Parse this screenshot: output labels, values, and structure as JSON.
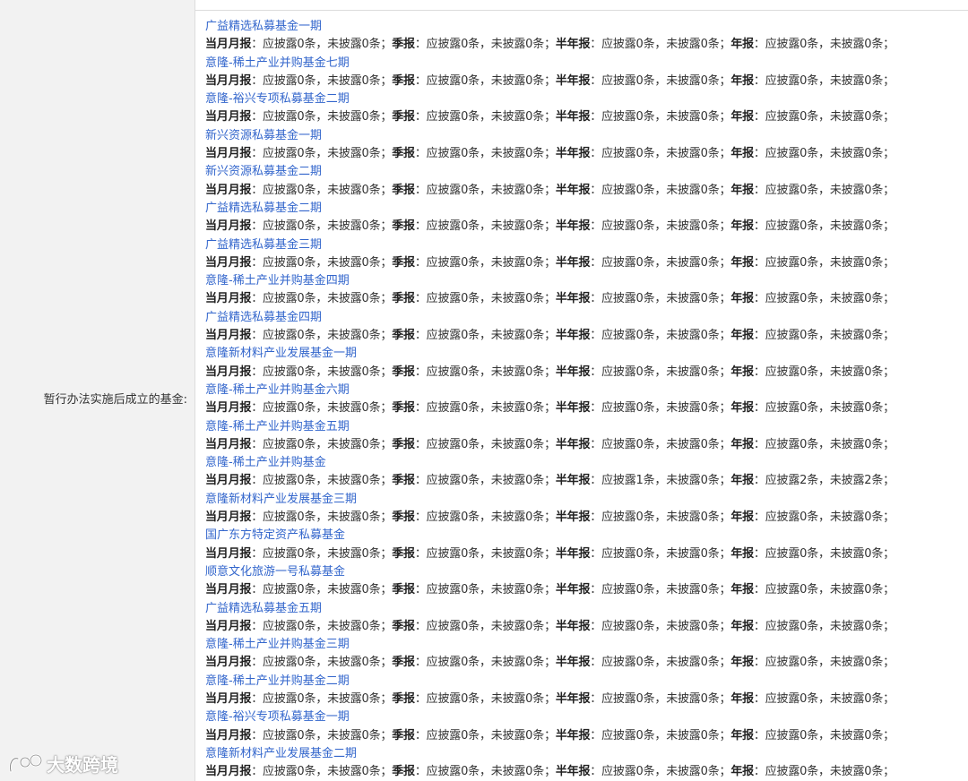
{
  "label": "暂行办法实施后成立的基金:",
  "terms": {
    "monthly": "当月月报",
    "quarterly": "季报",
    "semiannual": "半年报",
    "annual": "年报",
    "should_prefix": "应披露",
    "not_prefix": "未披露",
    "unit": "条"
  },
  "funds": [
    {
      "name": "广益精选私募基金一期",
      "m": [
        0,
        0
      ],
      "q": [
        0,
        0
      ],
      "h": [
        0,
        0
      ],
      "y": [
        0,
        0
      ]
    },
    {
      "name": "意隆-稀土产业并购基金七期",
      "m": [
        0,
        0
      ],
      "q": [
        0,
        0
      ],
      "h": [
        0,
        0
      ],
      "y": [
        0,
        0
      ]
    },
    {
      "name": "意隆-裕兴专项私募基金二期",
      "m": [
        0,
        0
      ],
      "q": [
        0,
        0
      ],
      "h": [
        0,
        0
      ],
      "y": [
        0,
        0
      ]
    },
    {
      "name": "新兴资源私募基金一期",
      "m": [
        0,
        0
      ],
      "q": [
        0,
        0
      ],
      "h": [
        0,
        0
      ],
      "y": [
        0,
        0
      ]
    },
    {
      "name": "新兴资源私募基金二期",
      "m": [
        0,
        0
      ],
      "q": [
        0,
        0
      ],
      "h": [
        0,
        0
      ],
      "y": [
        0,
        0
      ]
    },
    {
      "name": "广益精选私募基金二期",
      "m": [
        0,
        0
      ],
      "q": [
        0,
        0
      ],
      "h": [
        0,
        0
      ],
      "y": [
        0,
        0
      ]
    },
    {
      "name": "广益精选私募基金三期",
      "m": [
        0,
        0
      ],
      "q": [
        0,
        0
      ],
      "h": [
        0,
        0
      ],
      "y": [
        0,
        0
      ]
    },
    {
      "name": "意隆-稀土产业并购基金四期",
      "m": [
        0,
        0
      ],
      "q": [
        0,
        0
      ],
      "h": [
        0,
        0
      ],
      "y": [
        0,
        0
      ]
    },
    {
      "name": "广益精选私募基金四期",
      "m": [
        0,
        0
      ],
      "q": [
        0,
        0
      ],
      "h": [
        0,
        0
      ],
      "y": [
        0,
        0
      ]
    },
    {
      "name": "意隆新材料产业发展基金一期",
      "m": [
        0,
        0
      ],
      "q": [
        0,
        0
      ],
      "h": [
        0,
        0
      ],
      "y": [
        0,
        0
      ]
    },
    {
      "name": "意隆-稀土产业并购基金六期",
      "m": [
        0,
        0
      ],
      "q": [
        0,
        0
      ],
      "h": [
        0,
        0
      ],
      "y": [
        0,
        0
      ]
    },
    {
      "name": "意隆-稀土产业并购基金五期",
      "m": [
        0,
        0
      ],
      "q": [
        0,
        0
      ],
      "h": [
        0,
        0
      ],
      "y": [
        0,
        0
      ]
    },
    {
      "name": "意隆-稀土产业并购基金",
      "m": [
        0,
        0
      ],
      "q": [
        0,
        0
      ],
      "h": [
        1,
        0
      ],
      "y": [
        2,
        2
      ]
    },
    {
      "name": "意隆新材料产业发展基金三期",
      "m": [
        0,
        0
      ],
      "q": [
        0,
        0
      ],
      "h": [
        0,
        0
      ],
      "y": [
        0,
        0
      ]
    },
    {
      "name": "国广东方特定资产私募基金",
      "m": [
        0,
        0
      ],
      "q": [
        0,
        0
      ],
      "h": [
        0,
        0
      ],
      "y": [
        0,
        0
      ]
    },
    {
      "name": "顺意文化旅游一号私募基金",
      "m": [
        0,
        0
      ],
      "q": [
        0,
        0
      ],
      "h": [
        0,
        0
      ],
      "y": [
        0,
        0
      ]
    },
    {
      "name": "广益精选私募基金五期",
      "m": [
        0,
        0
      ],
      "q": [
        0,
        0
      ],
      "h": [
        0,
        0
      ],
      "y": [
        0,
        0
      ]
    },
    {
      "name": "意隆-稀土产业并购基金三期",
      "m": [
        0,
        0
      ],
      "q": [
        0,
        0
      ],
      "h": [
        0,
        0
      ],
      "y": [
        0,
        0
      ]
    },
    {
      "name": "意隆-稀土产业并购基金二期",
      "m": [
        0,
        0
      ],
      "q": [
        0,
        0
      ],
      "h": [
        0,
        0
      ],
      "y": [
        0,
        0
      ]
    },
    {
      "name": "意隆-裕兴专项私募基金一期",
      "m": [
        0,
        0
      ],
      "q": [
        0,
        0
      ],
      "h": [
        0,
        0
      ],
      "y": [
        0,
        0
      ]
    },
    {
      "name": "意隆新材料产业发展基金二期",
      "m": [
        0,
        0
      ],
      "q": [
        0,
        0
      ],
      "h": [
        0,
        0
      ],
      "y": [
        0,
        0
      ]
    }
  ],
  "watermark": "大数跨境"
}
